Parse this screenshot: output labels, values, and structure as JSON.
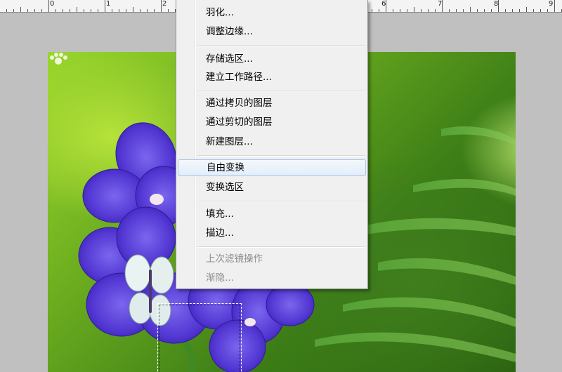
{
  "ruler": {
    "labels": [
      "0",
      "1",
      "2",
      "6",
      "7",
      "8",
      "9"
    ]
  },
  "menu": {
    "items": [
      {
        "label": "羽化...",
        "enabled": true
      },
      {
        "label": "调整边缘...",
        "enabled": true
      },
      {
        "label": "存储选区...",
        "enabled": true
      },
      {
        "label": "建立工作路径...",
        "enabled": true
      },
      {
        "label": "通过拷贝的图层",
        "enabled": true
      },
      {
        "label": "通过剪切的图层",
        "enabled": true
      },
      {
        "label": "新建图层...",
        "enabled": true
      },
      {
        "label": "自由变换",
        "enabled": true,
        "highlighted": true
      },
      {
        "label": "变换选区",
        "enabled": true
      },
      {
        "label": "填充...",
        "enabled": true
      },
      {
        "label": "描边...",
        "enabled": true
      },
      {
        "label": "上次滤镜操作",
        "enabled": false
      },
      {
        "label": "渐隐...",
        "enabled": false
      }
    ]
  },
  "colors": {
    "menu_bg": "#f0f0f0",
    "highlight_border": "#a9c7ec",
    "disabled_text": "#8d8d8d",
    "flower": "#5a3fd6",
    "workspace": "#c0c0c0"
  }
}
